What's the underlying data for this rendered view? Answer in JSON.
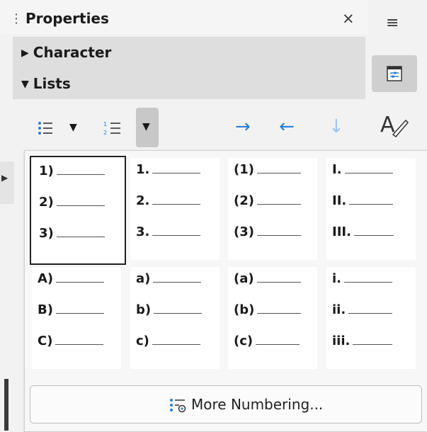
{
  "header": {
    "title": "Properties",
    "close_icon": "close-icon",
    "menu_icon": "hamburger-menu-icon"
  },
  "sections": {
    "character": {
      "label": "Character",
      "expanded": false
    },
    "lists": {
      "label": "Lists",
      "expanded": true
    }
  },
  "toolbar": {
    "items": [
      "unordered-list-icon",
      "dropdown-arrow-icon",
      "ordered-list-icon",
      "dropdown-arrow-icon",
      "demote-arrow-icon",
      "promote-arrow-icon",
      "move-down-arrow-icon"
    ]
  },
  "numbering": {
    "rows": [
      [
        [
          "1)",
          "2)",
          "3)"
        ],
        [
          "1.",
          "2.",
          "3."
        ],
        [
          "(1)",
          "(2)",
          "(3)"
        ],
        [
          "I.",
          "II.",
          "III."
        ]
      ],
      [
        [
          "A)",
          "B)",
          "C)"
        ],
        [
          "a)",
          "b)",
          "c)"
        ],
        [
          "(a)",
          "(b)",
          "(c)"
        ],
        [
          "i.",
          "ii.",
          "iii."
        ]
      ]
    ],
    "selected": "1)"
  },
  "more_button": {
    "label": "More Numbering..."
  },
  "colors": {
    "accent": "#2a7fd6",
    "selection_border": "#222222"
  }
}
